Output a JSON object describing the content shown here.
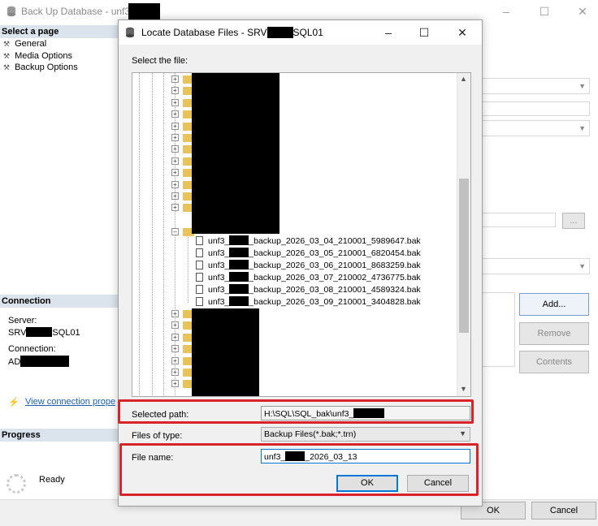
{
  "background": {
    "title": "Back Up Database - unf3",
    "window_controls": {
      "minimize": "–",
      "maximize": "☐",
      "close": "✕"
    },
    "left_pane": {
      "select_page_header": "Select a page",
      "pages": [
        "General",
        "Media Options",
        "Backup Options"
      ],
      "connection_header": "Connection",
      "server_label": "Server:",
      "server_prefix": "SRV",
      "server_suffix": "SQL01",
      "connection_label": "Connection:",
      "connection_prefix": "AD",
      "view_connection_link": "View connection prope",
      "progress_header": "Progress",
      "progress_status": "Ready"
    },
    "right_pane": {
      "add_button": "Add...",
      "remove_button": "Remove",
      "contents_button": "Contents",
      "browse_button": "..."
    },
    "footer": {
      "ok_button": "OK",
      "cancel_button": "Cancel"
    }
  },
  "dialog": {
    "title_prefix": "Locate Database Files - SRV",
    "title_suffix": "SQL01",
    "window_controls": {
      "minimize": "–",
      "maximize": "☐",
      "close": "✕"
    },
    "select_file_label": "Select the file:",
    "tree": {
      "expander_symbol": "+",
      "collapse_symbol": "–",
      "files": [
        {
          "prefix": "unf3_",
          "suffix": "_backup_2026_03_04_210001_5989647.bak"
        },
        {
          "prefix": "unf3_",
          "suffix": "_backup_2026_03_05_210001_6820454.bak"
        },
        {
          "prefix": "unf3_",
          "suffix": "_backup_2026_03_06_210001_8683259.bak"
        },
        {
          "prefix": "unf3_",
          "suffix": "_backup_2026_03_07_210002_4736775.bak"
        },
        {
          "prefix": "unf3_",
          "suffix": "_backup_2026_03_08_210001_4589324.bak"
        },
        {
          "prefix": "unf3_",
          "suffix": "_backup_2026_03_09_210001_3404828.bak"
        }
      ]
    },
    "selected_path_label": "Selected path:",
    "selected_path_value": "H:\\SQL\\SQL_bak\\unf3_",
    "files_of_type_label": "Files of type:",
    "files_of_type_value": "Backup Files(*.bak;*.trn)",
    "file_name_label": "File name:",
    "file_name_prefix": "unf3_",
    "file_name_suffix": "_2026_03_13",
    "ok_button": "OK",
    "cancel_button": "Cancel"
  },
  "colors": {
    "highlight": "#d9232a",
    "accent": "#0078d7",
    "link": "#1a5fb4"
  }
}
